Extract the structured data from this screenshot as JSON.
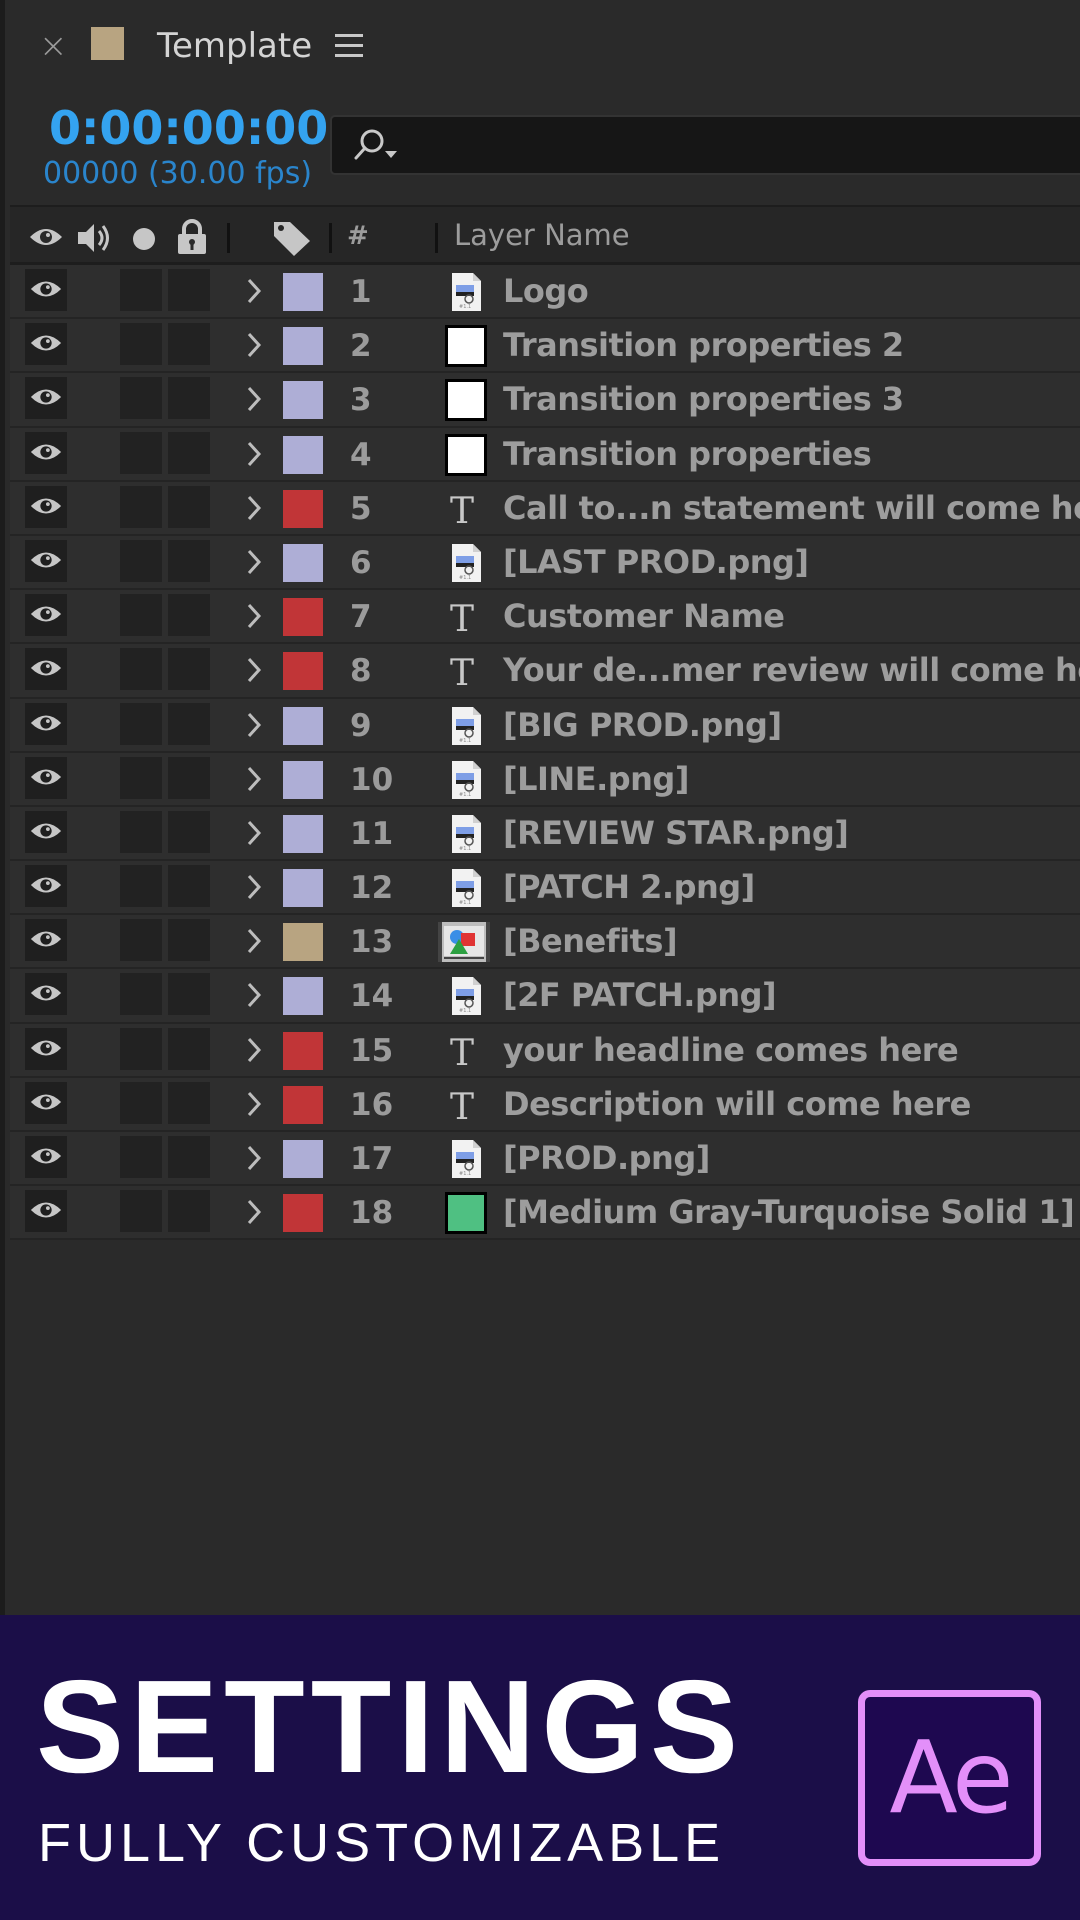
{
  "window": {
    "close_glyph": "×",
    "comp_color": "#b8a481",
    "title": "Template",
    "menu_icon": "hamburger-menu-icon"
  },
  "timecode": {
    "time": "0:00:00:00",
    "frames": "00000 (30.00 fps)"
  },
  "search": {
    "placeholder": "",
    "value": "",
    "icon": "search-icon"
  },
  "columns": {
    "av_icons": [
      "eye-icon",
      "speaker-icon",
      "solo-dot-icon",
      "lock-icon"
    ],
    "label_icon": "tag-icon",
    "number": "#",
    "layer_name": "Layer Name"
  },
  "colors": {
    "lavender": "#aeaed6",
    "red": "#c13537",
    "sandstone": "#b8a481",
    "timecode_blue": "#34a3f0",
    "solid_green": "#4fc082"
  },
  "layers": [
    {
      "num": "1",
      "label": "lavender",
      "type": "footage",
      "name": "Logo"
    },
    {
      "num": "2",
      "label": "lavender",
      "type": "solid-white",
      "name": "Transition properties 2"
    },
    {
      "num": "3",
      "label": "lavender",
      "type": "solid-white",
      "name": "Transition properties 3"
    },
    {
      "num": "4",
      "label": "lavender",
      "type": "solid-white",
      "name": "Transition properties"
    },
    {
      "num": "5",
      "label": "red",
      "type": "text",
      "name": "Call to...n statement will come here"
    },
    {
      "num": "6",
      "label": "lavender",
      "type": "footage",
      "name": "[LAST PROD.png]"
    },
    {
      "num": "7",
      "label": "red",
      "type": "text",
      "name": "Customer Name"
    },
    {
      "num": "8",
      "label": "red",
      "type": "text",
      "name": "Your de...mer review will come here"
    },
    {
      "num": "9",
      "label": "lavender",
      "type": "footage",
      "name": "[BIG PROD.png]"
    },
    {
      "num": "10",
      "label": "lavender",
      "type": "footage",
      "name": "[LINE.png]"
    },
    {
      "num": "11",
      "label": "lavender",
      "type": "footage",
      "name": "[REVIEW STAR.png]"
    },
    {
      "num": "12",
      "label": "lavender",
      "type": "footage",
      "name": "[PATCH 2.png]"
    },
    {
      "num": "13",
      "label": "sandstone",
      "type": "composition",
      "name": "[Benefits]"
    },
    {
      "num": "14",
      "label": "lavender",
      "type": "footage",
      "name": "[2F PATCH.png]"
    },
    {
      "num": "15",
      "label": "red",
      "type": "text",
      "name": "your headline comes here"
    },
    {
      "num": "16",
      "label": "red",
      "type": "text",
      "name": "Description will come here"
    },
    {
      "num": "17",
      "label": "lavender",
      "type": "footage",
      "name": "[PROD.png]"
    },
    {
      "num": "18",
      "label": "red",
      "type": "solid-green",
      "name": "[Medium Gray-Turquoise Solid 1]"
    }
  ],
  "banner": {
    "title": "SETTINGS",
    "subtitle": "FULLY CUSTOMIZABLE",
    "logo_text": "Ae",
    "background": "#1b0e48",
    "logo_color": "#e38ff9"
  }
}
